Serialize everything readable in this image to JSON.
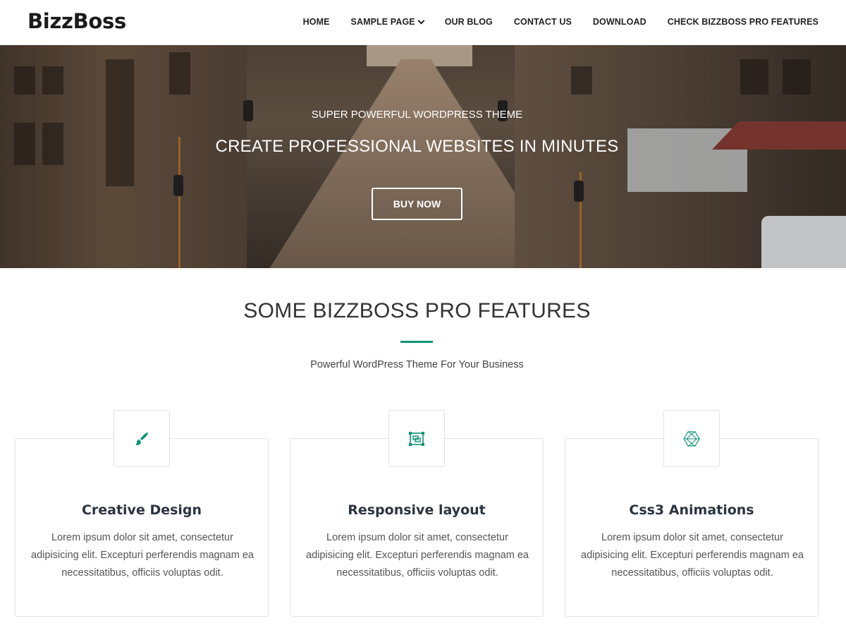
{
  "header": {
    "logo": "BizzBoss",
    "nav": [
      {
        "label": "HOME"
      },
      {
        "label": "SAMPLE PAGE",
        "has_dropdown": true
      },
      {
        "label": "OUR BLOG"
      },
      {
        "label": "CONTACT US"
      },
      {
        "label": "DOWNLOAD"
      },
      {
        "label": "CHECK BIZZBOSS PRO FEATURES"
      }
    ]
  },
  "hero": {
    "subtitle": "SUPER POWERFUL WORDPRESS THEME",
    "title": "CREATE PROFESSIONAL WEBSITES IN MINUTES",
    "button_label": "BUY NOW"
  },
  "features": {
    "title": "SOME BIZZBOSS PRO FEATURES",
    "subtitle": "Powerful WordPress Theme For Your Business",
    "accent_color": "#0e9475",
    "cards": [
      {
        "icon": "brush-icon",
        "title": "Creative Design",
        "text": "Lorem ipsum dolor sit amet, consectetur adipisicing elit. Excepturi perferendis magnam ea necessitatibus, officiis voluptas odit."
      },
      {
        "icon": "responsive-layout-icon",
        "title": "Responsive layout",
        "text": "Lorem ipsum dolor sit amet, consectetur adipisicing elit. Excepturi perferendis magnam ea necessitatibus, officiis voluptas odit."
      },
      {
        "icon": "hexagon-animation-icon",
        "title": "Css3 Animations",
        "text": "Lorem ipsum dolor sit amet, consectetur adipisicing elit. Excepturi perferendis magnam ea necessitatibus, officiis voluptas odit."
      }
    ]
  }
}
